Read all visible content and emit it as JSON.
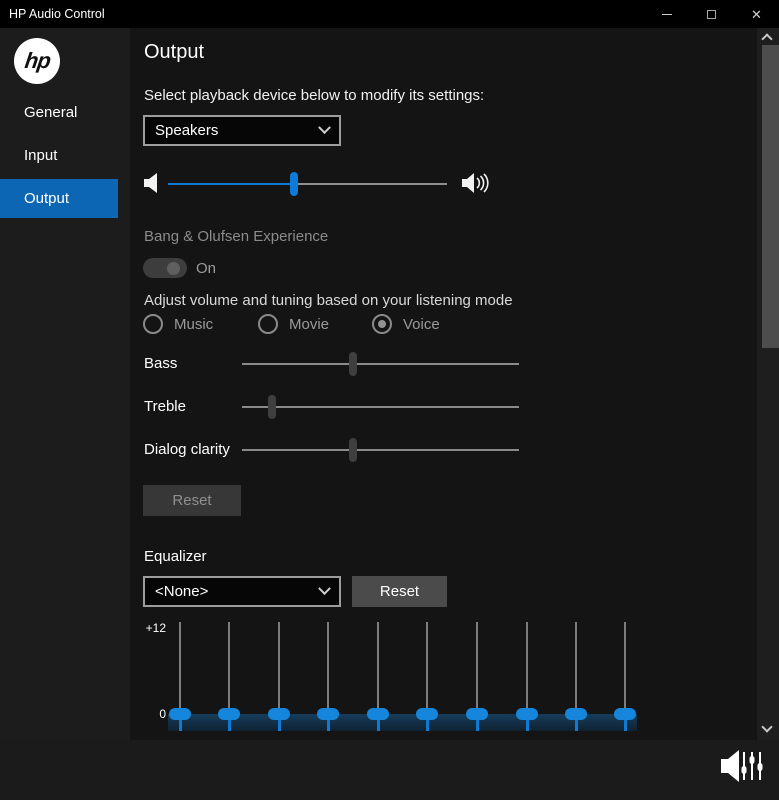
{
  "window": {
    "title": "HP Audio Control"
  },
  "titlebar": {
    "close_glyph": "✕"
  },
  "sidebar": {
    "logo_text": "hp",
    "items": [
      {
        "label": "General",
        "selected": false
      },
      {
        "label": "Input",
        "selected": false
      },
      {
        "label": "Output",
        "selected": true
      }
    ]
  },
  "main": {
    "heading": "Output",
    "device_section": {
      "label": "Select playback device below to modify its settings:",
      "selected_device": "Speakers"
    },
    "volume": {
      "percent": 45
    },
    "bang_olufsen": {
      "label": "Bang & Olufsen Experience",
      "toggle_label": "On",
      "enabled": false
    },
    "listening_mode": {
      "label": "Adjust volume and tuning based on your listening mode",
      "options": [
        {
          "label": "Music",
          "selected": false
        },
        {
          "label": "Movie",
          "selected": false
        },
        {
          "label": "Voice",
          "selected": true
        }
      ]
    },
    "tuning": [
      {
        "label": "Bass",
        "percent": 40
      },
      {
        "label": "Treble",
        "percent": 11
      },
      {
        "label": "Dialog clarity",
        "percent": 40
      }
    ],
    "tuning_reset_label": "Reset",
    "equalizer": {
      "label": "Equalizer",
      "preset": "<None>",
      "reset_label": "Reset",
      "scale_max_label": "+12",
      "scale_zero_label": "0",
      "band_count": 10,
      "band_values_db": [
        0,
        0,
        0,
        0,
        0,
        0,
        0,
        0,
        0,
        0
      ]
    }
  },
  "colors": {
    "accent_blue": "#0c7bd9",
    "sidebar_selected_blue": "#0d66b3",
    "eq_thumb_blue": "#1586db"
  }
}
